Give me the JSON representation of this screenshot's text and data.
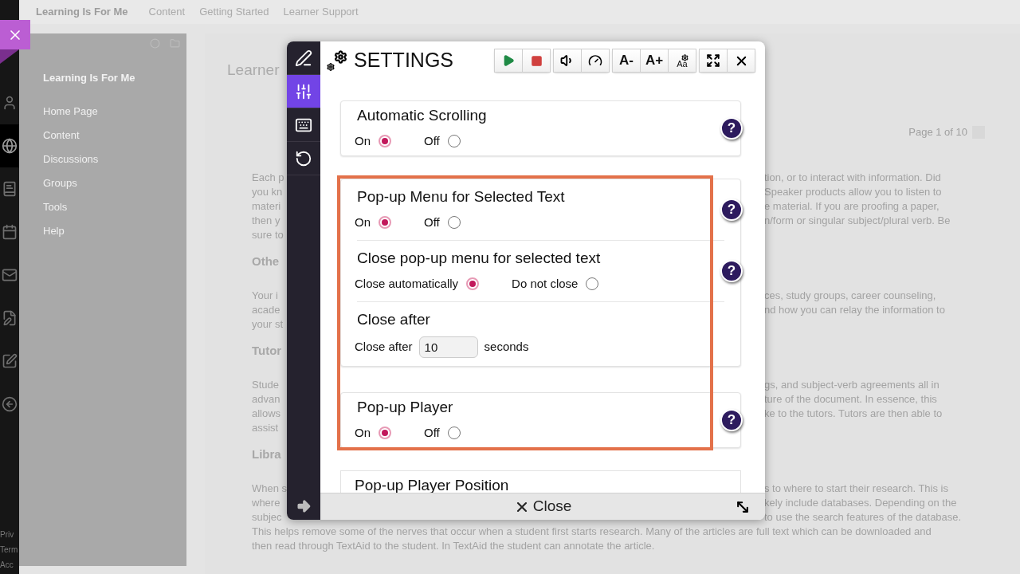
{
  "top_nav": {
    "site_title": "Learning Is For Me",
    "links": [
      "Content",
      "Getting Started",
      "Learner Support"
    ]
  },
  "left_rail": {
    "icons": [
      {
        "kind": "user",
        "selected": false
      },
      {
        "kind": "globe",
        "selected": true
      },
      {
        "kind": "book",
        "selected": false
      },
      {
        "kind": "calendar",
        "selected": false
      },
      {
        "kind": "mail",
        "selected": false
      },
      {
        "kind": "document",
        "selected": false
      },
      {
        "kind": "edit",
        "selected": false
      },
      {
        "kind": "logout",
        "selected": false
      }
    ],
    "footer_links": [
      "Priv",
      "Term",
      "Acc"
    ]
  },
  "course_menu": {
    "title": "Learning Is For Me",
    "items": [
      "Home Page",
      "Content",
      "Discussions",
      "Groups",
      "Tools",
      "Help"
    ]
  },
  "content": {
    "heading": "Learner",
    "page_indicator": "Page 1 of 10",
    "body": [
      {
        "kind": "split",
        "left": "Each p",
        "right": "tion, or to interact with information. Did"
      },
      {
        "kind": "split",
        "left": "you kn",
        "right": "Speaker products allow you to listen to"
      },
      {
        "kind": "split",
        "left": "materi",
        "right": "e material. If you are proofing a paper,"
      },
      {
        "kind": "split",
        "left": "then y",
        "right": "n/form or singular subject/plural verb. Be"
      },
      {
        "kind": "split",
        "left": "sure to"
      },
      {
        "kind": "heading",
        "left": "Othe"
      },
      {
        "kind": "split",
        "left": "Your i",
        "right": "ces, study groups, career counseling,"
      },
      {
        "kind": "split",
        "left": "acade",
        "right": "nd how you can relay the information to"
      },
      {
        "kind": "split",
        "left": "your st"
      },
      {
        "kind": "heading",
        "left": "Tutor"
      },
      {
        "kind": "split",
        "left": "Stude",
        "right": "gs, and subject-verb agreements all in"
      },
      {
        "kind": "split",
        "left": "advan",
        "right": "ture of the document. In essence, this"
      },
      {
        "kind": "split",
        "left": "allows",
        "right": "ke to the tutors. Tutors are then able to"
      },
      {
        "kind": "split",
        "left": "assist"
      },
      {
        "kind": "heading",
        "left": "Libra"
      },
      {
        "kind": "split",
        "left": "When s",
        "right": "s to where to start their research. This is"
      },
      {
        "kind": "split",
        "left": "where",
        "right": "kely include databases. Depending on the"
      },
      {
        "kind": "split",
        "left": "subjec",
        "right": "to use the search features of the database."
      },
      {
        "kind": "full",
        "left": "This helps remove some of the nerves that occur when a student first starts research. Many of the articles are full text which can be downloaded and"
      },
      {
        "kind": "full",
        "left": "then read through TextAid to the student. In TextAid the student can annotate the article."
      }
    ]
  },
  "settings_dialog": {
    "title": "SETTINGS",
    "toolbar": [
      [
        {
          "kind": "play"
        },
        {
          "kind": "stop"
        }
      ],
      [
        {
          "kind": "speaker"
        },
        {
          "kind": "speed"
        }
      ],
      [
        {
          "kind": "text",
          "label": "A-"
        },
        {
          "kind": "text",
          "label": "A+"
        },
        {
          "kind": "style",
          "label": "Aa"
        }
      ],
      [
        {
          "kind": "fullscreen"
        },
        {
          "kind": "close"
        }
      ]
    ],
    "side_tabs": [
      {
        "kind": "pen",
        "selected": false
      },
      {
        "kind": "sliders",
        "selected": true
      },
      {
        "kind": "keyboard",
        "selected": false
      },
      {
        "kind": "undo",
        "selected": false
      }
    ],
    "cards": [
      {
        "highlighted": false,
        "settings": [
          {
            "kind": "radio",
            "title": "Automatic Scrolling",
            "help": "?",
            "options": [
              {
                "label": "On",
                "selected": true
              },
              {
                "label": "Off",
                "selected": false
              }
            ]
          }
        ]
      },
      {
        "highlighted": true,
        "settings": [
          {
            "kind": "radio",
            "title": "Pop-up Menu for Selected Text",
            "help": "?",
            "options": [
              {
                "label": "On",
                "selected": true
              },
              {
                "label": "Off",
                "selected": false
              }
            ]
          },
          {
            "kind": "radio",
            "title": "Close pop-up menu for selected text",
            "help": "?",
            "options": [
              {
                "label": "Close automatically",
                "selected": true
              },
              {
                "label": "Do not close",
                "selected": false
              }
            ]
          },
          {
            "kind": "number",
            "title": "Close after",
            "label": "Close after",
            "value": "10",
            "unit": "seconds"
          }
        ]
      },
      {
        "highlighted": true,
        "settings": [
          {
            "kind": "radio",
            "title": "Pop-up Player",
            "help": "?",
            "options": [
              {
                "label": "On",
                "selected": true
              },
              {
                "label": "Off",
                "selected": false
              }
            ]
          }
        ]
      },
      {
        "highlighted": false,
        "settings": [
          {
            "kind": "heading",
            "title": "Pop-up Player Position"
          }
        ]
      }
    ],
    "close_button": "Close"
  }
}
